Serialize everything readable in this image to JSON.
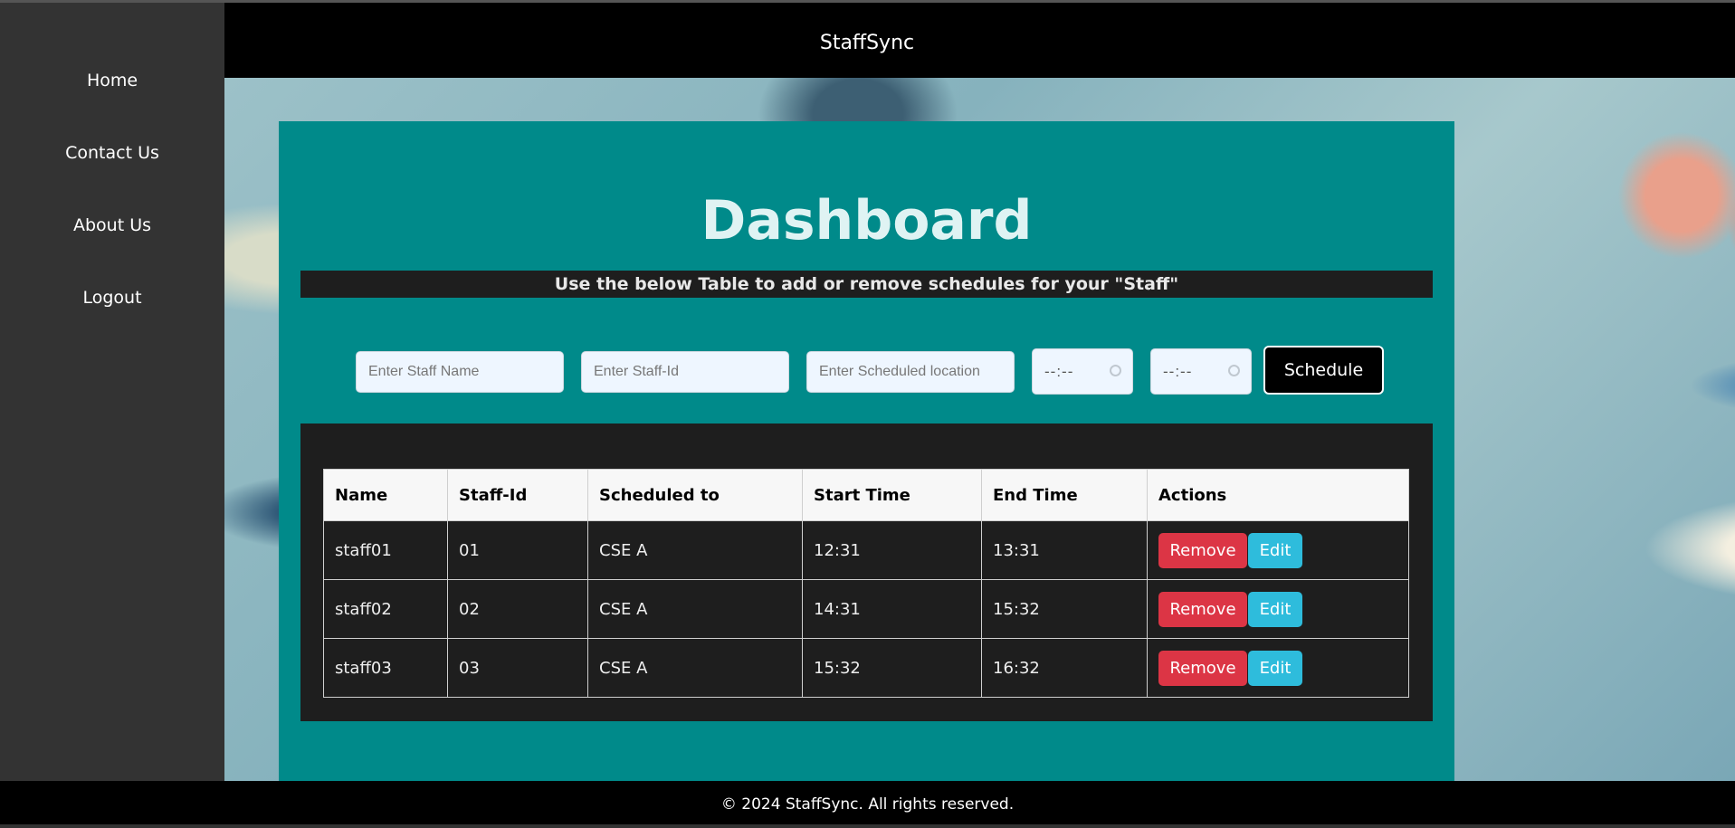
{
  "header": {
    "brand": "StaffSync"
  },
  "sidebar": {
    "items": [
      {
        "label": "Home"
      },
      {
        "label": "Contact Us"
      },
      {
        "label": "About Us"
      },
      {
        "label": "Logout"
      }
    ]
  },
  "main": {
    "title": "Dashboard",
    "subtitle": "Use the below Table to add or remove schedules for your \"Staff\"",
    "form": {
      "staff_name_placeholder": "Enter Staff Name",
      "staff_id_placeholder": "Enter Staff-Id",
      "location_placeholder": "Enter Scheduled location",
      "start_time_placeholder": "--:--",
      "end_time_placeholder": "--:--",
      "schedule_label": "Schedule"
    },
    "table": {
      "headers": [
        "Name",
        "Staff-Id",
        "Scheduled to",
        "Start Time",
        "End Time",
        "Actions"
      ],
      "rows": [
        {
          "name": "staff01",
          "staff_id": "01",
          "scheduled_to": "CSE A",
          "start": "12:31",
          "end": "13:31"
        },
        {
          "name": "staff02",
          "staff_id": "02",
          "scheduled_to": "CSE A",
          "start": "14:31",
          "end": "15:32"
        },
        {
          "name": "staff03",
          "staff_id": "03",
          "scheduled_to": "CSE A",
          "start": "15:32",
          "end": "16:32"
        }
      ],
      "remove_label": "Remove",
      "edit_label": "Edit"
    }
  },
  "footer": {
    "text": "© 2024 StaffSync. All rights reserved."
  },
  "colors": {
    "sidebar": "#333333",
    "header": "#000000",
    "card": "#008a8a",
    "panel": "#1e1e1e",
    "remove": "#dc3545",
    "edit": "#2ebcdc"
  }
}
